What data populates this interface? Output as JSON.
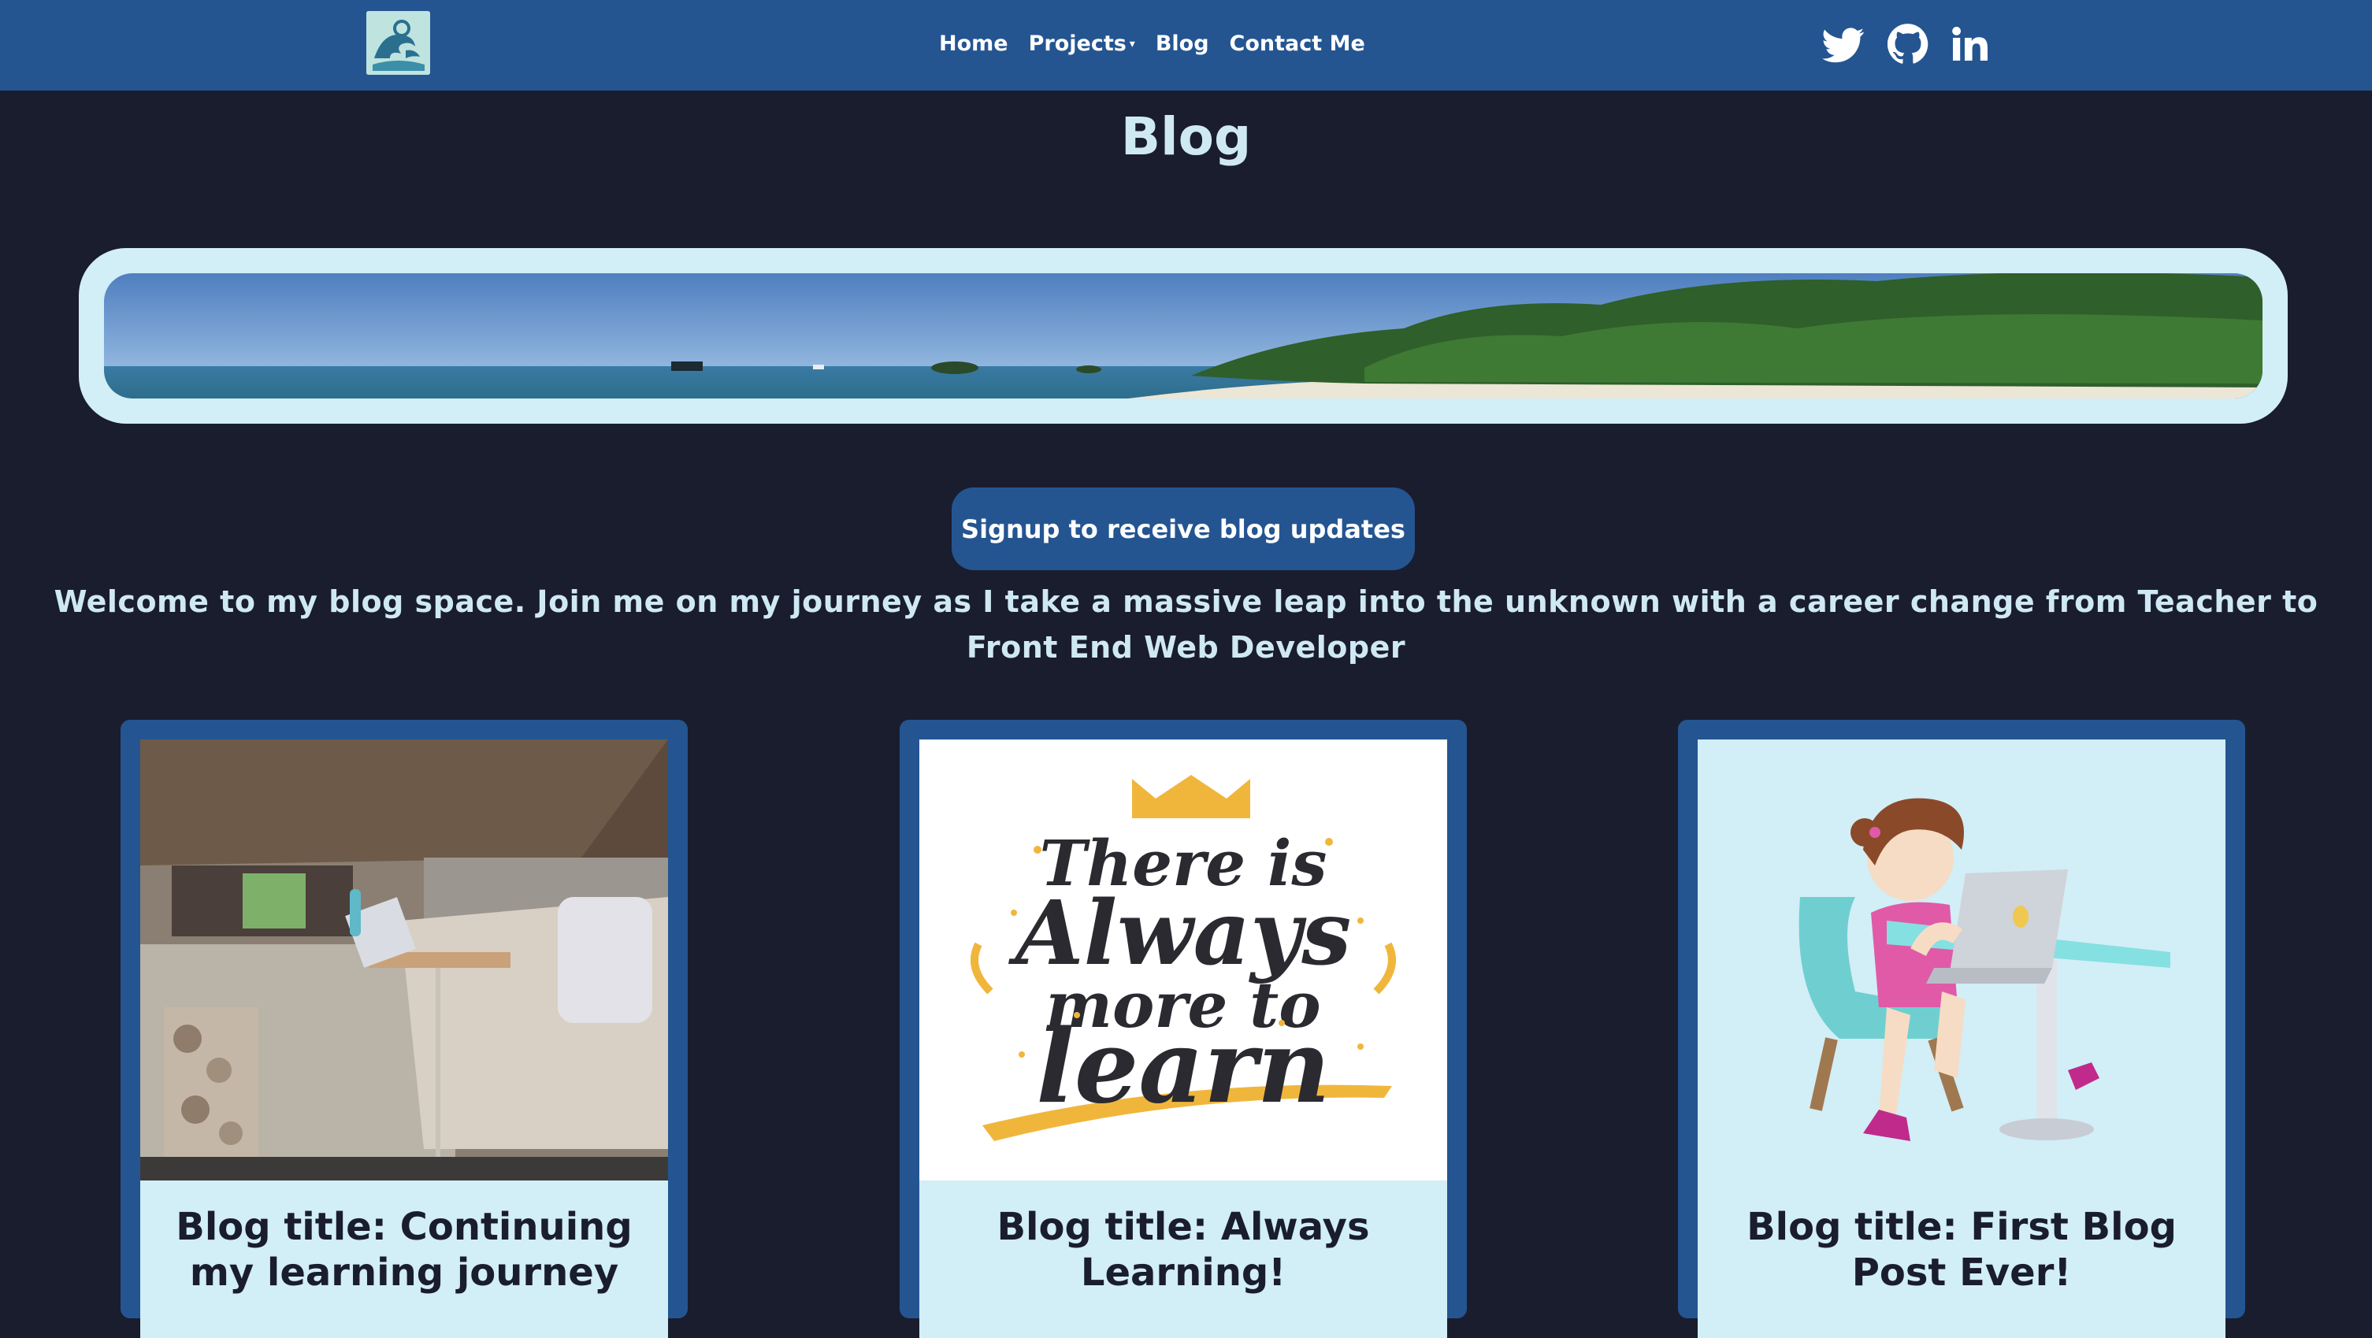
{
  "nav": {
    "links": [
      "Home",
      "Projects",
      "Blog",
      "Contact Me"
    ],
    "social": [
      "twitter-icon",
      "github-icon",
      "linkedin-icon"
    ]
  },
  "page": {
    "title": "Blog",
    "signup_label": "Signup to receive blog updates",
    "welcome": "Welcome to my blog space. Join me on my journey as I take a massive leap into the unknown with a career change from Teacher to Front End Web Developer"
  },
  "cards": [
    {
      "title": "Blog title: Continuing my learning journey"
    },
    {
      "title": "Blog title: Always Learning!",
      "image_text": [
        "There is",
        "Always",
        "more to",
        "learn"
      ]
    },
    {
      "title": "Blog title: First Blog Post Ever!"
    }
  ],
  "colors": {
    "nav": "#245591",
    "background": "#1a1d2e",
    "text": "#cfe9f3",
    "panel": "#d2eef6"
  }
}
